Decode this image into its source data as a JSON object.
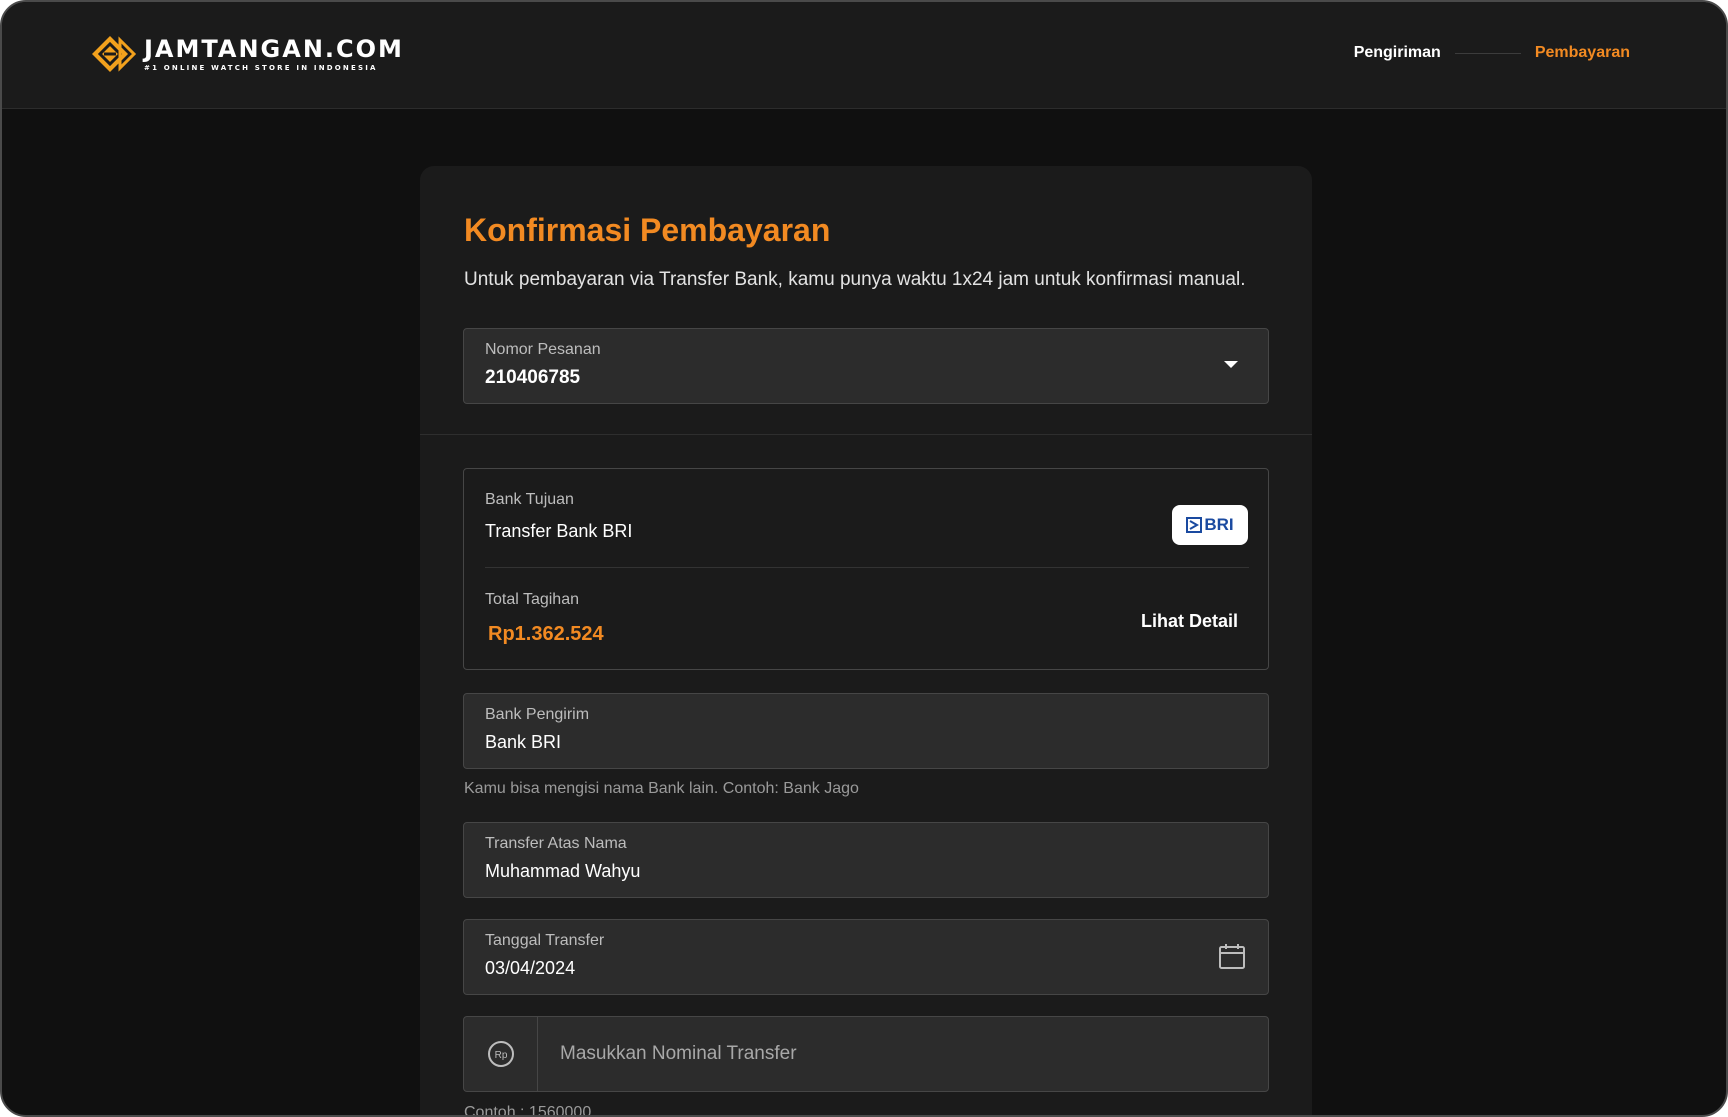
{
  "header": {
    "logo_title": "JAMTANGAN.COM",
    "logo_tagline": "#1 ONLINE WATCH STORE IN INDONESIA",
    "steps": [
      "Pengiriman",
      "Pembayaran"
    ],
    "active_step": "Pembayaran"
  },
  "card": {
    "title": "Konfirmasi Pembayaran",
    "description": "Untuk pembayaran via Transfer Bank, kamu punya waktu 1x24 jam untuk konfirmasi manual.",
    "order": {
      "label": "Nomor Pesanan",
      "value": "210406785"
    },
    "destination": {
      "label": "Bank Tujuan",
      "value": "Transfer Bank BRI",
      "badge": "BRI",
      "total_label": "Total Tagihan",
      "total_value": "Rp1.362.524",
      "detail_link": "Lihat Detail"
    },
    "sender_bank": {
      "label": "Bank Pengirim",
      "value": "Bank BRI",
      "hint": "Kamu bisa mengisi nama Bank lain. Contoh: Bank Jago"
    },
    "account_name": {
      "label": "Transfer Atas Nama",
      "value": "Muhammad Wahyu"
    },
    "transfer_date": {
      "label": "Tanggal Transfer",
      "value": "03/04/2024"
    },
    "amount": {
      "currency_symbol": "Rp",
      "placeholder": "Masukkan Nominal Transfer",
      "hint": "Contoh : 1560000"
    }
  },
  "colors": {
    "accent": "#f28a22",
    "background": "#101010",
    "surface": "#1b1b1b",
    "field": "#2c2c2c",
    "bri_blue": "#1a4aa0"
  }
}
